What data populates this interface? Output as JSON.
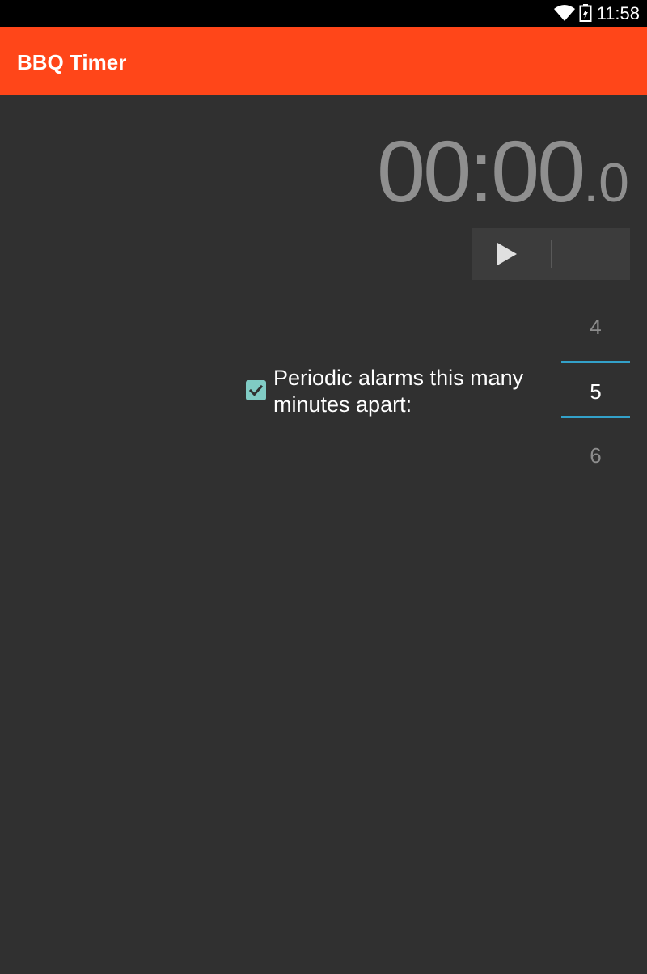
{
  "status_bar": {
    "time": "11:58",
    "icons": [
      "wifi-icon",
      "battery-icon"
    ]
  },
  "app_bar": {
    "title": "BBQ Timer",
    "color": "#ff4619"
  },
  "timer": {
    "main": "00:00",
    "tenths": ".0"
  },
  "controls": {
    "play_icon": "play-icon"
  },
  "periodic_alarm": {
    "checked": true,
    "label": "Periodic alarms this many minutes apart:",
    "checkbox_color": "#80cbc4"
  },
  "interval_picker": {
    "previous": "4",
    "current": "5",
    "next": "6",
    "accent_color": "#33a1c9"
  }
}
